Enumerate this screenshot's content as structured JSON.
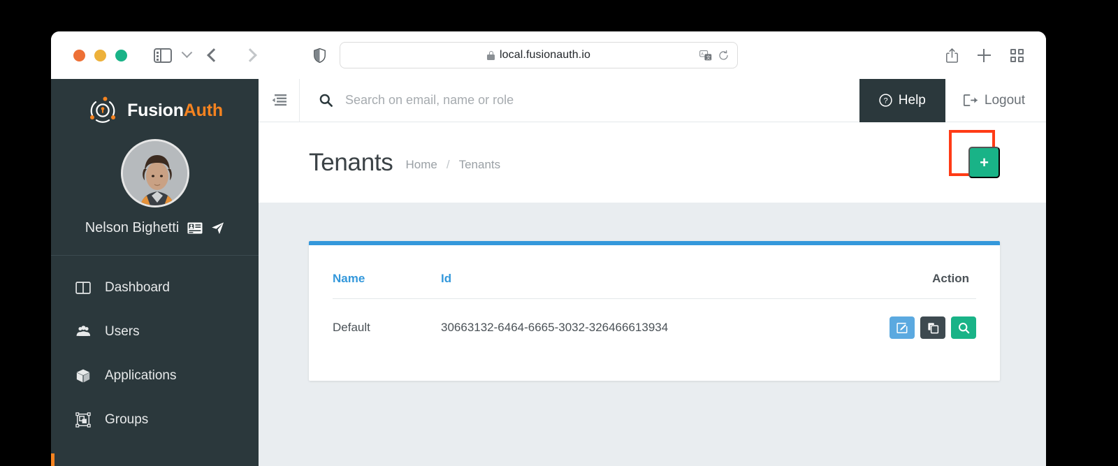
{
  "browser": {
    "traffic_lights": [
      "close-red",
      "minimize-yellow",
      "maximize-green"
    ],
    "sidebar_toggle_icon": "sidebar-panel-icon",
    "tab_dropdown_icon": "chevron-down-icon",
    "back_icon": "chevron-left-icon",
    "forward_icon": "chevron-right-icon",
    "shield_icon": "privacy-shield-icon",
    "url": "local.fusionauth.io",
    "lock_icon": "lock-icon",
    "translate_icon": "translate-icon",
    "reload_icon": "reload-icon",
    "share_icon": "share-icon",
    "new_tab_icon": "plus-icon",
    "tab_overview_icon": "grid-icon"
  },
  "sidebar": {
    "brand": {
      "first": "Fusion",
      "second": "Auth",
      "logo_icon": "fusionauth-logo-icon"
    },
    "user": {
      "name": "Nelson Bighetti",
      "avatar_icon": "user-avatar",
      "idcard_icon": "id-card-icon",
      "send_icon": "paper-plane-icon"
    },
    "items": [
      {
        "label": "Dashboard",
        "icon": "dashboard-icon"
      },
      {
        "label": "Users",
        "icon": "users-icon"
      },
      {
        "label": "Applications",
        "icon": "cube-icon"
      },
      {
        "label": "Groups",
        "icon": "groups-icon"
      }
    ]
  },
  "topbar": {
    "collapse_icon": "sidebar-collapse-icon",
    "search": {
      "placeholder": "Search on email, name or role",
      "value": "",
      "icon": "search-icon"
    },
    "help": {
      "label": "Help",
      "icon": "question-circle-icon"
    },
    "logout": {
      "label": "Logout",
      "icon": "logout-icon"
    }
  },
  "page": {
    "title": "Tenants",
    "breadcrumb": {
      "home": "Home",
      "separator": "/",
      "current": "Tenants"
    },
    "add_button": {
      "label": "+",
      "icon": "plus-icon"
    }
  },
  "table": {
    "columns": [
      "Name",
      "Id",
      "Action"
    ],
    "rows": [
      {
        "name": "Default",
        "id": "30663132-6464-6665-3032-326466613934",
        "actions": [
          {
            "name": "edit-tenant-button",
            "icon": "edit-icon"
          },
          {
            "name": "duplicate-tenant-button",
            "icon": "copy-icon"
          },
          {
            "name": "view-tenant-button",
            "icon": "search-icon"
          }
        ]
      }
    ]
  },
  "colors": {
    "brand_orange": "#f58320",
    "sidebar_bg": "#2b383c",
    "accent_green": "#19b387",
    "accent_blue": "#3498db",
    "highlight_red": "#ff3b16",
    "content_bg": "#e9edf0"
  }
}
